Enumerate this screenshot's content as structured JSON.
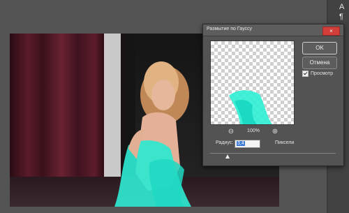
{
  "right_panel": {
    "top_icon": "A",
    "second_icon": "¶"
  },
  "dialog": {
    "title": "Размытие по Гауссу",
    "close_icon": "×",
    "ok_label": "OK",
    "cancel_label": "Отмена",
    "preview_label": "Просмотр",
    "preview_checked": true,
    "zoom_out_icon": "⊖",
    "zoom_in_icon": "⊕",
    "zoom_value": "100%",
    "radius_label": "Радиус:",
    "radius_value": "3,4",
    "radius_unit": "Пиксели"
  },
  "colors": {
    "accent": "#3b78d6",
    "close": "#d23f3a",
    "dress_highlight": "#2ef0d4",
    "curtain": "#5a1b2a",
    "hair": "#d9a46a",
    "skin": "#e8b59a"
  }
}
